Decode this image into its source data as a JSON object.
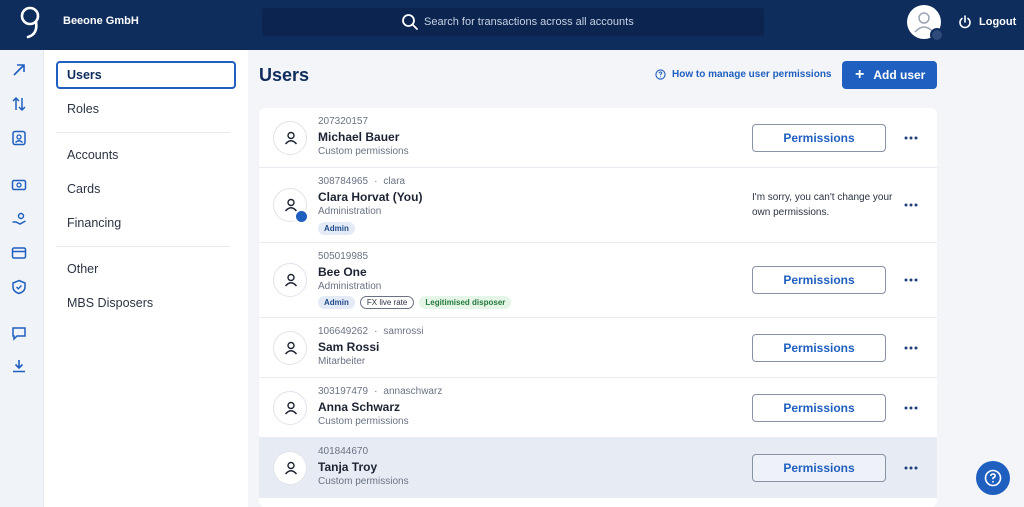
{
  "header": {
    "company": "Beeone GmbH",
    "search_placeholder": "Search for transactions across all accounts",
    "logout_label": "Logout"
  },
  "rail_icons": [
    "arrow-up-right-icon",
    "swap-arrows-icon",
    "contact-card-icon",
    "banknote-icon",
    "hand-coins-icon",
    "cards-icon",
    "shield-icon",
    "chat-icon",
    "download-icon"
  ],
  "subnav": {
    "items": [
      {
        "label": "Users",
        "active": true
      },
      {
        "label": "Roles"
      },
      {
        "label": "Accounts"
      },
      {
        "label": "Cards"
      },
      {
        "label": "Financing"
      },
      {
        "label": "Other"
      },
      {
        "label": "MBS Disposers"
      }
    ]
  },
  "main": {
    "title": "Users",
    "help_link": "How to manage user permissions",
    "add_user": "Add user",
    "permissions_label": "Permissions",
    "self_note": "I'm sorry, you can't change your own permissions.",
    "users": [
      {
        "id": "207320157",
        "username": "",
        "name": "Michael Bauer",
        "role": "Custom permissions",
        "tags": []
      },
      {
        "id": "308784965",
        "username": "clara",
        "name": "Clara Horvat (You)",
        "role": "Administration",
        "tags": [
          "Admin"
        ],
        "self": true
      },
      {
        "id": "505019985",
        "username": "",
        "name": "Bee One",
        "role": "Administration",
        "tags": [
          "Admin",
          "FX live rate",
          "Legitimised disposer"
        ]
      },
      {
        "id": "106649262",
        "username": "samrossi",
        "name": "Sam Rossi",
        "role": "Mitarbeiter",
        "tags": []
      },
      {
        "id": "303197479",
        "username": "annaschwarz",
        "name": "Anna Schwarz",
        "role": "Custom permissions",
        "tags": []
      },
      {
        "id": "401844670",
        "username": "",
        "name": "Tanja Troy",
        "role": "Custom permissions",
        "tags": [],
        "highlighted": true
      }
    ]
  },
  "colors": {
    "topbar": "#0f2d5c",
    "accent": "#1f5fbf"
  }
}
